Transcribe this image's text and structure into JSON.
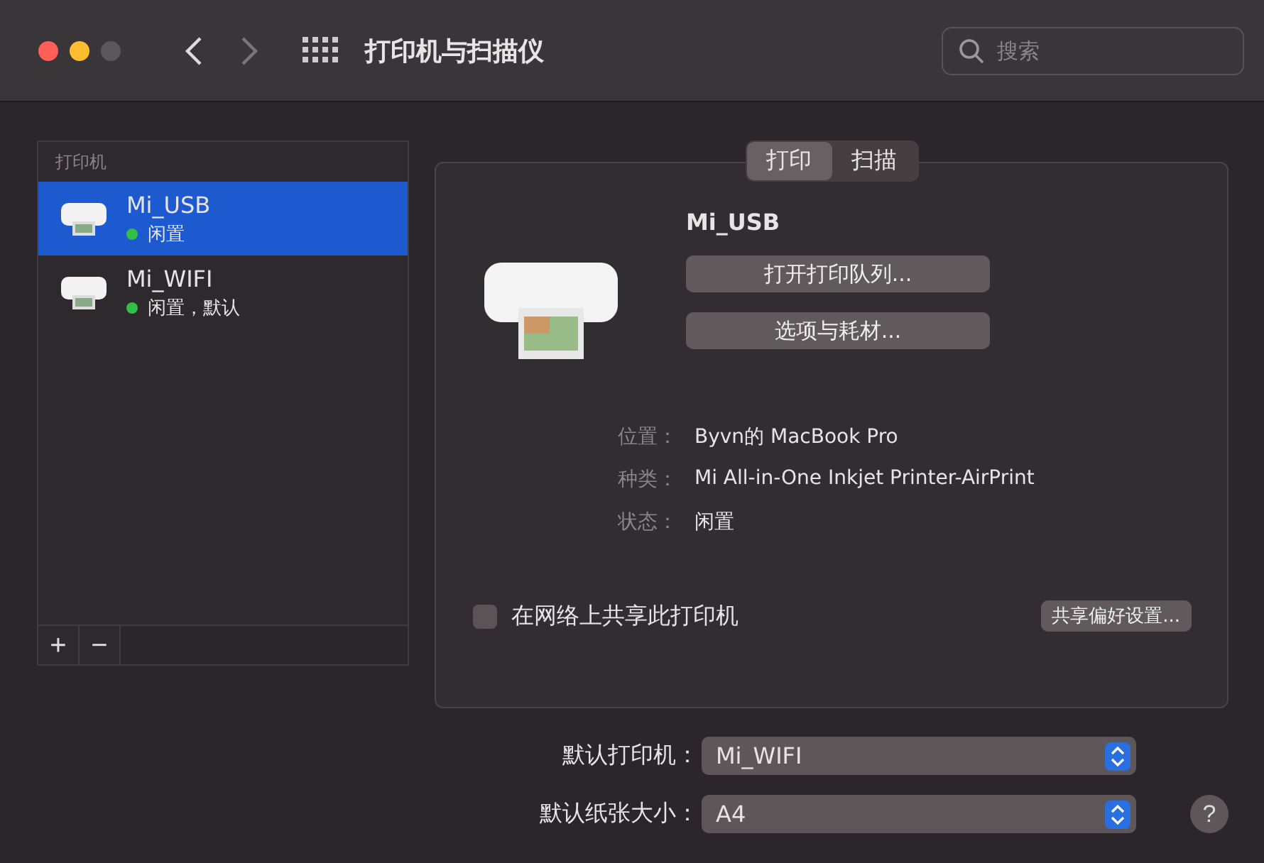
{
  "window": {
    "title": "打印机与扫描仪"
  },
  "search": {
    "placeholder": "搜索"
  },
  "sidebar": {
    "heading": "打印机",
    "items": [
      {
        "name": "Mi_USB",
        "status": "闲置",
        "color": "#30c048",
        "selected": true
      },
      {
        "name": "Mi_WIFI",
        "status": "闲置，默认",
        "color": "#30c048",
        "selected": false
      }
    ]
  },
  "tabs": [
    {
      "label": "打印",
      "selected": true
    },
    {
      "label": "扫描",
      "selected": false
    }
  ],
  "detail": {
    "name": "Mi_USB",
    "buttons": [
      "打开打印队列...",
      "选项与耗材..."
    ],
    "info": [
      {
        "label": "位置：",
        "value": "Byvn的 MacBook Pro"
      },
      {
        "label": "种类：",
        "value": "Mi All-in-One Inkjet Printer-AirPrint"
      },
      {
        "label": "状态：",
        "value": "闲置"
      }
    ],
    "share": {
      "label": "在网络上共享此打印机",
      "checked": false
    },
    "share_button": "共享偏好设置..."
  },
  "defaults": [
    {
      "label": "默认打印机：",
      "value": "Mi_WIFI"
    },
    {
      "label": "默认纸张大小：",
      "value": "A4"
    }
  ],
  "list_buttons": [
    "+",
    "−"
  ],
  "help": "?"
}
